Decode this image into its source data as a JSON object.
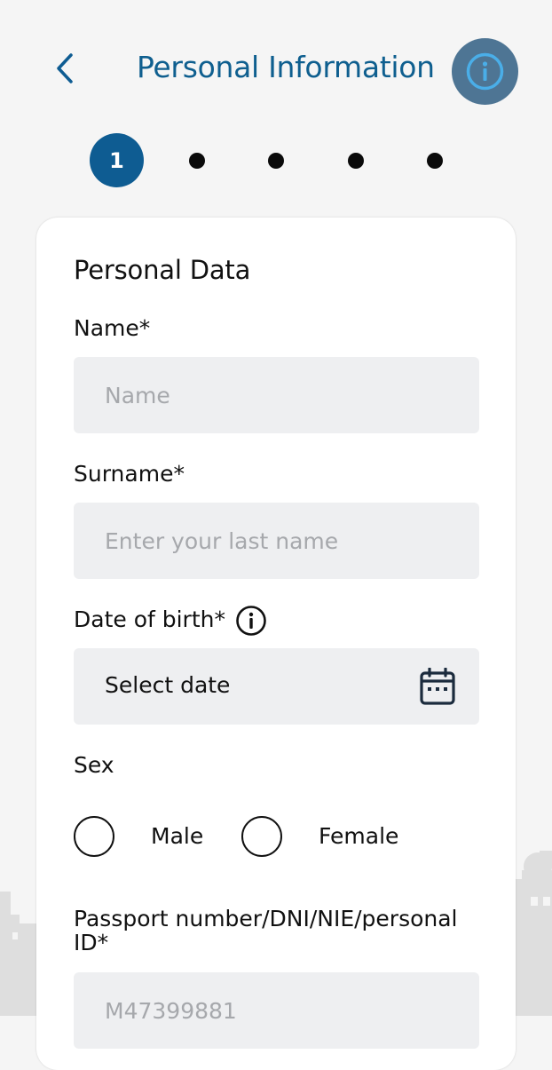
{
  "header": {
    "title": "Personal Information"
  },
  "stepper": {
    "current_step": "1",
    "total_steps": 5
  },
  "form": {
    "section_title": "Personal Data",
    "name": {
      "label": "Name*",
      "placeholder": "Name"
    },
    "surname": {
      "label": "Surname*",
      "placeholder": "Enter your last name"
    },
    "date_of_birth": {
      "label": "Date of birth*",
      "value": "Select date"
    },
    "sex": {
      "label": "Sex",
      "options": [
        "Male",
        "Female"
      ]
    },
    "passport": {
      "label": "Passport number/DNI/NIE/personal ID*",
      "placeholder": "M47399881"
    }
  },
  "icons": {
    "back": "chevron-left-icon",
    "info": "info-icon",
    "calendar": "calendar-icon"
  },
  "colors": {
    "primary": "#0e5c92",
    "title": "#0f5f8f",
    "info_button_bg": "#4e7594",
    "info_button_accent": "#4aaee8",
    "input_bg": "#eeeff1",
    "placeholder": "#a6a8ac",
    "background": "#f5f5f5",
    "skyline": "#dedede"
  }
}
